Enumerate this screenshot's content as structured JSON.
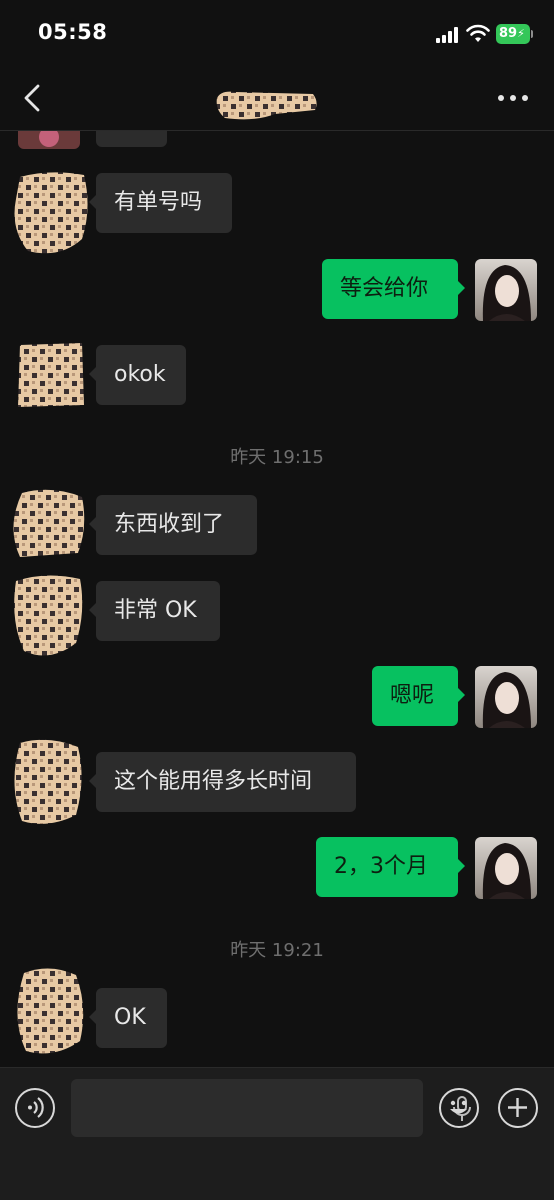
{
  "status": {
    "time": "05:58",
    "battery": "89"
  },
  "messages": {
    "m1": "有单号吗",
    "m2": "等会给你",
    "m3": "okok",
    "t1": "昨天 19:15",
    "m4": "东西收到了",
    "m5": "非常 OK",
    "m6": "嗯呢",
    "m7": "这个能用得多长时间",
    "m8": "2，3个月",
    "t2": "昨天 19:21",
    "m9": "OK"
  },
  "icons": {
    "back": "back-arrow-icon",
    "more": "more-dots-icon",
    "voice": "voice-mode-icon",
    "mic": "microphone-icon",
    "emoji": "emoji-icon",
    "plus": "plus-icon"
  },
  "colors": {
    "outgoing_bubble": "#07c160",
    "incoming_bubble": "#2c2c2c",
    "background": "#111111"
  }
}
